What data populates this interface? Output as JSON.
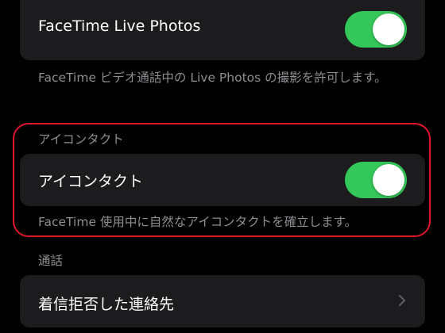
{
  "facetime_live_photos": {
    "label": "FaceTime Live Photos",
    "toggle_on": true,
    "footnote": "FaceTime ビデオ通話中の Live Photos の撮影を許可します。"
  },
  "eye_contact_section": {
    "header": "アイコンタクト",
    "row_label": "アイコンタクト",
    "toggle_on": true,
    "footnote": "FaceTime 使用中に自然なアイコンタクトを確立します。"
  },
  "calls_section": {
    "header": "通話",
    "blocked_contacts_label": "着信拒否した連絡先"
  },
  "colors": {
    "background": "#000000",
    "card": "#1c1c1e",
    "toggle_on": "#34c759",
    "secondary_text": "#8e8e93",
    "highlight": "#e0162b",
    "chevron": "#5c5c61"
  },
  "icons": {
    "blocked_contacts_chevron": "chevron-right-icon"
  }
}
